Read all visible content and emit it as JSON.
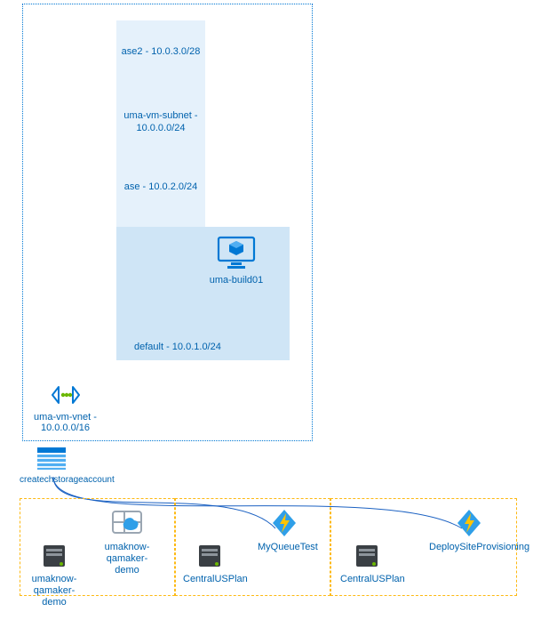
{
  "vnet": {
    "label": "uma-vm-vnet - 10.0.0.0/16",
    "subnets": {
      "ase2": "ase2 - 10.0.3.0/28",
      "vmsub": "uma-vm-subnet - 10.0.0.0/24",
      "ase": "ase - 10.0.2.0/24",
      "default": "default - 10.0.1.0/24"
    },
    "vm": "uma-build01"
  },
  "storage": "createchstorageaccount",
  "plans": {
    "a": {
      "plan_label": "umaknow-qamaker-demo",
      "webapp_label": "umaknow-qamaker-demo"
    },
    "b": {
      "plan_label": "CentralUSPlan",
      "func_label": "MyQueueTest"
    },
    "c": {
      "plan_label": "CentralUSPlan",
      "func_label": "DeploySiteProvisioning"
    }
  }
}
